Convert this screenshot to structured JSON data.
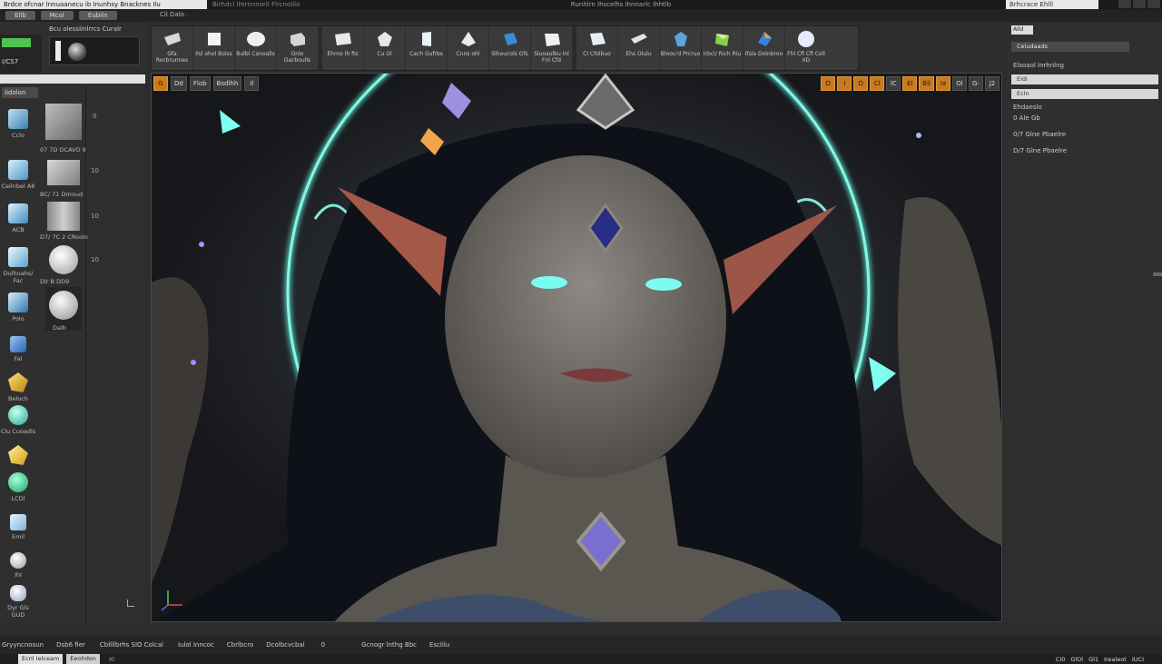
{
  "titlebar": {
    "app_title": "Brdce ofcnar lnnuaanecu ib Inunhsy Bnacknes Ilu",
    "doc_title": "Birhdcl Ihtrnnnorll Flrcnolilo",
    "center_title": "Runhlrn Ihscelhs Ihnnarlc Ihhtlb",
    "right_field": "Brhcrace Ehlll"
  },
  "menubar": {
    "items": [
      "Ellb",
      "Mcol",
      "Eubiln"
    ],
    "file_label": "Cil Dalo ."
  },
  "left_top": {
    "size_label": "I/CS7",
    "preset_title": "Bcu olesslinlrrcs Curalr"
  },
  "left_panel": {
    "tab": "Iidolon",
    "tools": [
      {
        "label": "Cclo",
        "icon": "sphere-tool-icon"
      },
      {
        "label": "Ceilnbel A8",
        "icon": "cube-tool-icon"
      },
      {
        "label": "ACB",
        "icon": "cylinder-tool-icon"
      },
      {
        "label": "Dulhuahs/ Fac",
        "icon": "brush-tool-icon"
      },
      {
        "label": "Polo",
        "icon": "plane-tool-icon"
      },
      {
        "label": "Fal",
        "icon": "material-tool-icon"
      },
      {
        "label": "Beloch",
        "icon": "gold-tool-icon"
      },
      {
        "label": "Clu Cuoadls",
        "icon": "teal-sphere-icon"
      },
      {
        "label": "LCDl",
        "icon": "gem-tool-icon"
      },
      {
        "label": "Emil",
        "icon": "cube-tool-icon"
      },
      {
        "label": "Ihl",
        "icon": "white-sphere-icon"
      },
      {
        "label": "Dyr Gls GUD",
        "icon": "light-tool-icon"
      }
    ],
    "materials": [
      {
        "label": "07 7D DCAVO 9",
        "num": "0"
      },
      {
        "label": "BC/ 71 Dmoud",
        "num": "10"
      },
      {
        "label": "D7/ 7C 2 CRoolo",
        "num": "10"
      },
      {
        "label": "Dlr B DD9",
        "num": "10"
      },
      {
        "label": "Dalb",
        "num": ""
      }
    ]
  },
  "ribbon": {
    "buttons": [
      {
        "label": "Gfa Rocbrunnes",
        "icon": "plane-shape-icon"
      },
      {
        "label": "Ilsl ohol Bolss",
        "icon": "cube-shape-icon"
      },
      {
        "label": "Bulbl Canoalls",
        "icon": "sphere-shape-icon"
      },
      {
        "label": "Onlo Dacboulls",
        "icon": "box-shape-icon"
      },
      {
        "label": "Ehrno Ih fts",
        "icon": "panel-shape-icon"
      },
      {
        "label": "Cu Ol",
        "icon": "gem-shape-icon"
      },
      {
        "label": "Cach Gufrbs",
        "icon": "prism-shape-icon"
      },
      {
        "label": "Cnns ohl",
        "icon": "cone-shape-icon"
      },
      {
        "label": "Slheucols Gfs",
        "icon": "shard-shape-icon"
      },
      {
        "label": "Sluoaolbu lnl Fnl Cfd",
        "icon": "slab-shape-icon"
      },
      {
        "label": "Cl Cfolbuo",
        "icon": "tile-shape-icon"
      },
      {
        "label": "Ehs Olulu",
        "icon": "bar-shape-icon"
      },
      {
        "label": "Bloou'd Prcruo",
        "icon": "crystal-shape-icon"
      },
      {
        "label": "Irbci/ Rich Riu",
        "icon": "prism2-shape-icon"
      },
      {
        "label": "Ifsla Dolnbroo",
        "icon": "gem2-shape-icon"
      },
      {
        "label": "Fhl Cfl Cfl Coll IID",
        "icon": "orb-shape-icon"
      }
    ]
  },
  "viewport": {
    "left_buttons": [
      "G",
      "Dd",
      "Flob",
      "Bsdlhh",
      "Il"
    ],
    "right_buttons": [
      "D",
      "I",
      "D",
      "Cl",
      "lC",
      "El",
      "Bil",
      "Ia",
      "Ol",
      "G-",
      "J2"
    ]
  },
  "right_panel": {
    "header": "Alld",
    "field1": "Celudaads",
    "section_title": "Elsoaol Inrhnlng",
    "field2": "Eidi",
    "field3": "Ecln",
    "label1": "Ehdaeslo",
    "label2": "0 Ale Gb",
    "row1": "0/7  Glne Pbaelre",
    "row2": "D/7  Glne Pbaelre"
  },
  "status": {
    "items": [
      "Gryyncnosun",
      "Dsb6 fier",
      "Cbllllbrhs SIO Colcal",
      "Iulol Inncoc",
      "Cbrlbcro",
      "Dcolbcvcbal",
      "0",
      "Gcnogr lnthg Bbc",
      "Esclilu"
    ],
    "tab1": "Ecnl Ielceam",
    "tab2": "Eeolrdon",
    "tab_num": "I0",
    "right": [
      "Cl0",
      "GlOl",
      "Gl1",
      "Irealeot",
      "IUCI"
    ]
  },
  "colors": {
    "accent_orange": "#c97a1c",
    "accent_green": "#4fc24f",
    "rune_glow": "#5cf0d8"
  }
}
